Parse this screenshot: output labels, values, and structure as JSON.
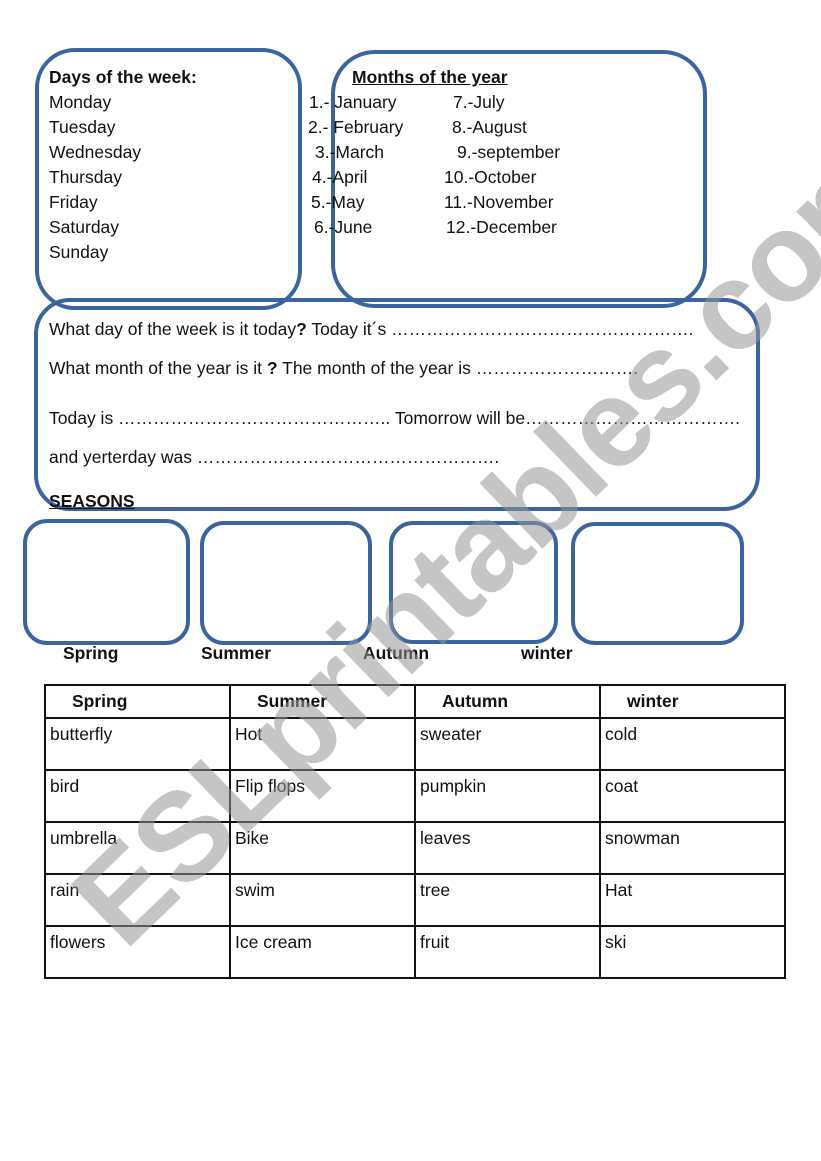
{
  "days": {
    "title": "Days of the week:",
    "items": [
      "Monday",
      "Tuesday",
      "Wednesday",
      "Thursday",
      "Friday",
      "Saturday",
      "Sunday"
    ]
  },
  "months": {
    "title": "Months of the year",
    "col1": [
      "1.- January",
      "2.- February",
      "3.-March",
      "4.-April",
      "5.-May",
      "6.-June"
    ],
    "col2": [
      "7.-July",
      "8.-August",
      "9.-september",
      "10.-October",
      "11.-November",
      "12.-December"
    ]
  },
  "questions": {
    "q1_text": "What day of the week is it today",
    "q1_mark": "?",
    "q1_answer": " Today it´s …………………………………………….",
    "q2_text": "What month of the year is it ",
    "q2_mark": "?",
    "q2_answer": " The month of the year is ……………………….",
    "q3": "Today is ……………………………………….. Tomorrow will be……………………………….",
    "q4": "and yerterday was ……………………………………………."
  },
  "seasons_heading": "SEASONS",
  "season_labels": [
    "Spring",
    "Summer",
    "Autumn",
    "winter"
  ],
  "table": {
    "headers": [
      "Spring",
      "Summer",
      "Autumn",
      "winter"
    ],
    "rows": [
      [
        "butterfly",
        "Hot",
        "sweater",
        "cold"
      ],
      [
        "bird",
        "Flip flops",
        "pumpkin",
        "coat"
      ],
      [
        "umbrella",
        "Bike",
        "leaves",
        "snowman"
      ],
      [
        "rain",
        "swim",
        "tree",
        "Hat"
      ],
      [
        "flowers",
        "Ice cream",
        "fruit",
        "ski"
      ]
    ]
  },
  "watermark": "ESLprintables.com",
  "colors": {
    "box_border": "#3a64a0"
  }
}
